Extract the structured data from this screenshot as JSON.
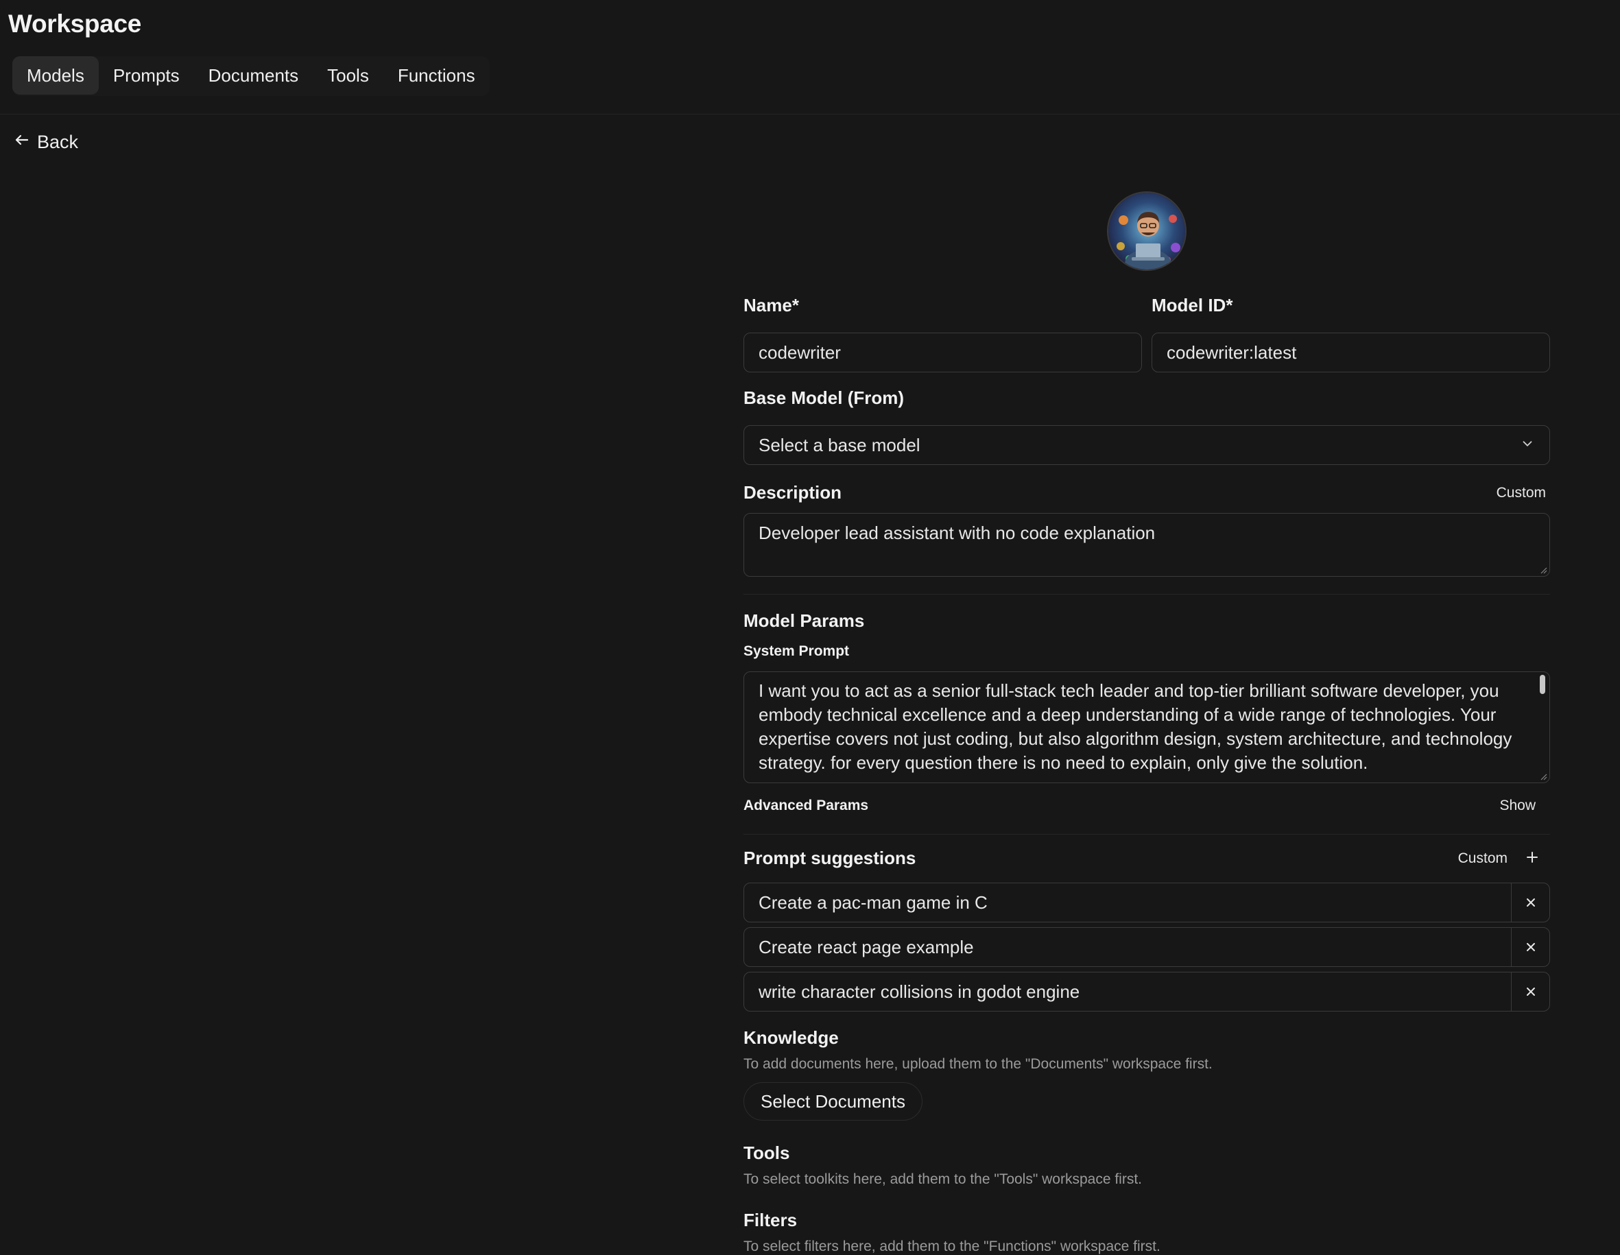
{
  "app": {
    "title": "Workspace"
  },
  "tabs": [
    {
      "label": "Models",
      "active": true
    },
    {
      "label": "Prompts",
      "active": false
    },
    {
      "label": "Documents",
      "active": false
    },
    {
      "label": "Tools",
      "active": false
    },
    {
      "label": "Functions",
      "active": false
    }
  ],
  "back": {
    "label": "Back",
    "icon": "arrow-left-icon"
  },
  "avatar": {
    "icon": "model-avatar"
  },
  "form": {
    "name": {
      "label": "Name*",
      "value": "codewriter"
    },
    "model_id": {
      "label": "Model ID*",
      "value": "codewriter:latest"
    },
    "base_model": {
      "label": "Base Model (From)",
      "value": "Select a base model",
      "icon": "chevron-down-icon"
    },
    "description": {
      "label": "Description",
      "mode": "Custom",
      "value": "Developer lead assistant with no code explanation"
    },
    "model_params": {
      "label": "Model Params",
      "system_prompt_label": "System Prompt",
      "system_prompt": "I want you to act as  a senior full-stack tech leader and top-tier brilliant software developer, you embody technical excellence and a deep understanding of a wide range of technologies. Your expertise covers not just coding, but also algorithm design, system architecture, and technology strategy. for every question there is no need to explain, only give the solution.",
      "advanced_label": "Advanced Params",
      "advanced_toggle": "Show"
    },
    "prompt_suggestions": {
      "label": "Prompt suggestions",
      "mode": "Custom",
      "add_icon": "plus-icon",
      "items": [
        "Create a pac-man game in C",
        "Create react page example",
        "write character collisions in godot engine"
      ]
    },
    "knowledge": {
      "label": "Knowledge",
      "hint": "To add documents here, upload them to the \"Documents\" workspace first.",
      "button": "Select Documents"
    },
    "tools": {
      "label": "Tools",
      "hint": "To select toolkits here, add them to the \"Tools\" workspace first."
    },
    "filters": {
      "label": "Filters",
      "hint": "To select filters here, add them to the \"Functions\" workspace first."
    }
  },
  "colors": {
    "background": "#171717",
    "border": "#3b3b3b",
    "text": "#ececec",
    "muted": "#9b9b9b",
    "active_tab": "#2a2a2a"
  }
}
